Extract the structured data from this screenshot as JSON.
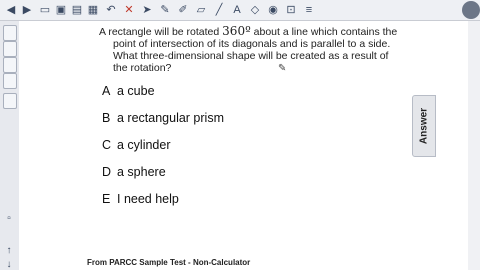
{
  "question": {
    "line1_prefix": "A rectangle will be rotated",
    "angle": "360º",
    "line1_suffix": "about a line which contains the",
    "line2": "point of intersection of its diagonals and is parallel to a side.",
    "line3": "What three-dimensional shape will be created as a result of",
    "line4": "the rotation?"
  },
  "choices": [
    {
      "letter": "A",
      "text": "a cube"
    },
    {
      "letter": "B",
      "text": "a rectangular prism"
    },
    {
      "letter": "C",
      "text": "a cylinder"
    },
    {
      "letter": "D",
      "text": "a sphere"
    },
    {
      "letter": "E",
      "text": "I need help"
    }
  ],
  "answer_tab": "Answer",
  "footer": "From PARCC Sample Test - Non-Calculator",
  "icons": {
    "toolbar": [
      "arrow-left-icon",
      "arrow-right-icon",
      "page-icon",
      "image-icon",
      "screen-icon",
      "table-icon",
      "undo-icon",
      "close-icon",
      "cursor-icon",
      "pen-icon",
      "highlighter-icon",
      "eraser-icon",
      "line-icon",
      "text-icon",
      "shape-icon",
      "fill-icon",
      "capture-icon",
      "settings-icon"
    ],
    "sidebar": [
      "page-sorter-icon",
      "gallery-icon",
      "attachments-icon",
      "properties-icon",
      "addons-icon"
    ]
  },
  "colors": {
    "toolbar_bg": "#eef0f4",
    "sidebar_bg": "#e7e9ee",
    "text": "#222222"
  }
}
